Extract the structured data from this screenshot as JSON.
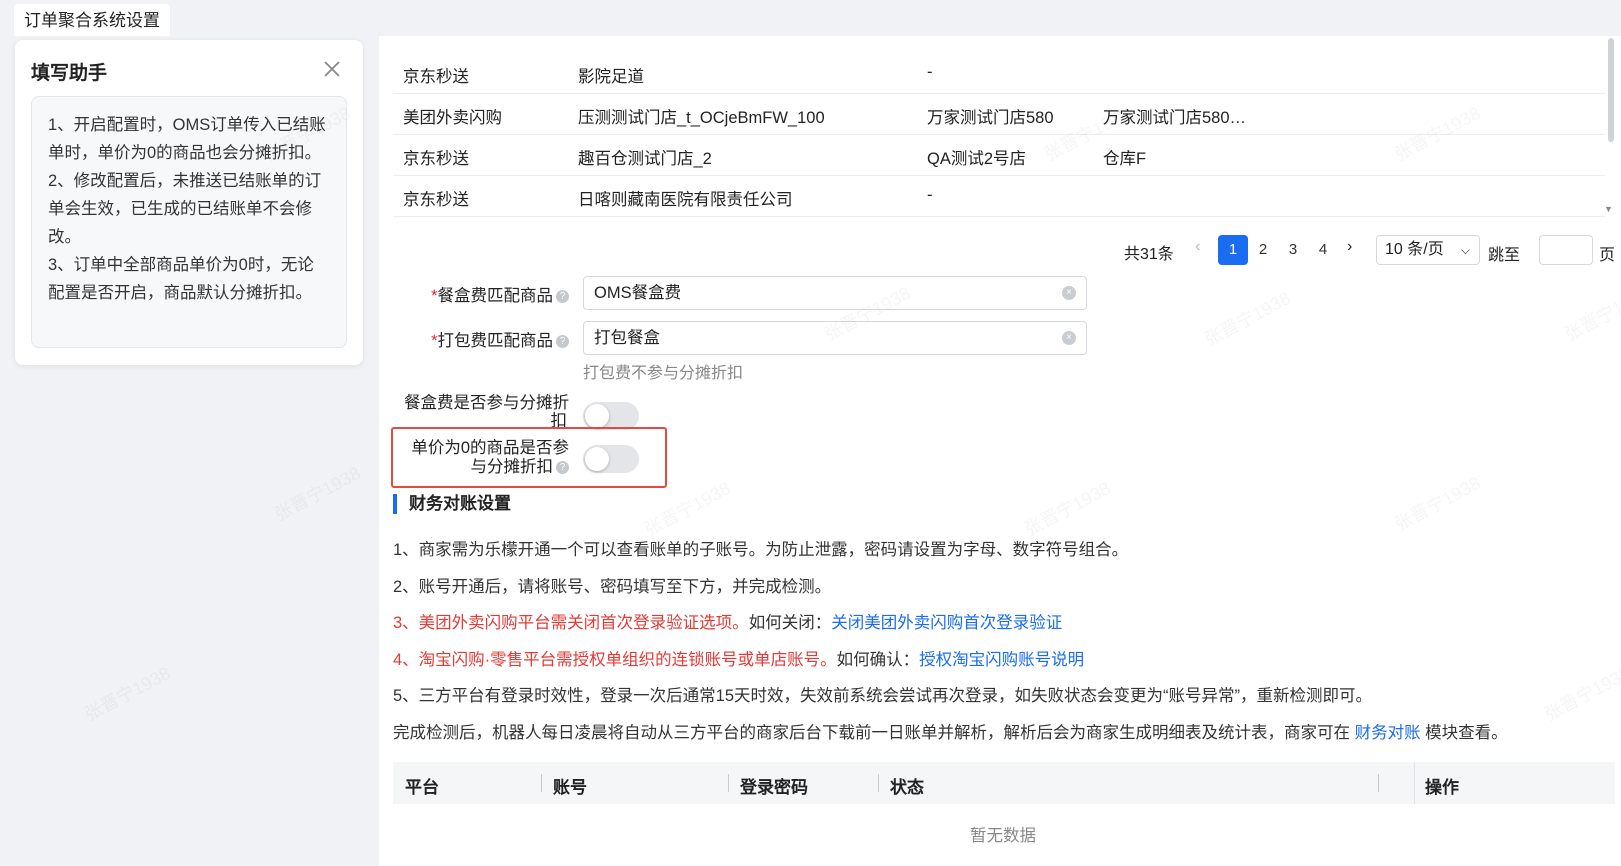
{
  "window_tab": "订单聚合系统设置",
  "helper": {
    "title": "填写助手",
    "notes": [
      "1、开启配置时，OMS订单传入已结账单时，单价为0的商品也会分摊折扣。",
      "2、修改配置后，未推送已结账单的订单会生效，已生成的已结账单不会修改。",
      "3、订单中全部商品单价为0时，无论配置是否开启，商品默认分摊折扣。"
    ]
  },
  "store_table": {
    "rows": [
      [
        "京东秒送",
        "影院足道",
        "-",
        ""
      ],
      [
        "美团外卖闪购",
        "压测测试门店_t_OCjeBmFW_100",
        "万家测试门店580",
        "万家测试门店580…"
      ],
      [
        "京东秒送",
        "趣百仓测试门店_2",
        "QA测试2号店",
        "仓库F"
      ],
      [
        "京东秒送",
        "日喀则藏南医院有限责任公司",
        "-",
        ""
      ]
    ]
  },
  "pagination": {
    "total": "共31条",
    "pages": [
      "1",
      "2",
      "3",
      "4"
    ],
    "current": "1",
    "page_size": "10 条/页",
    "jump_label": "跳至",
    "page_suffix": "页"
  },
  "form": {
    "box_fee_label": "餐盒费匹配商品",
    "box_fee_value": "OMS餐盒费",
    "pack_fee_label": "打包费匹配商品",
    "pack_fee_value": "打包餐盒",
    "pack_fee_hint": "打包费不参与分摊折扣",
    "box_discount_label_1": "餐盒费是否参与分摊折",
    "box_discount_label_2": "扣",
    "zero_price_label_1": "单价为0的商品是否参",
    "zero_price_label_2": "与分摊折扣",
    "box_discount_on": false,
    "zero_price_on": false
  },
  "finance": {
    "title": "财务对账设置",
    "note1": "1、商家需为乐檬开通一个可以查看账单的子账号。为防止泄露，密码请设置为字母、数字符号组合。",
    "note2": "2、账号开通后，请将账号、密码填写至下方，并完成检测。",
    "note3_red": "3、美团外卖闪购平台需关闭首次登录验证选项。",
    "note3_plain": "如何关闭：",
    "note3_link": "关闭美团外卖闪购首次登录验证",
    "note4_red": "4、淘宝闪购·零售平台需授权单组织的连锁账号或单店账号。",
    "note4_plain": "如何确认：",
    "note4_link": "授权淘宝闪购账号说明",
    "note5": "5、三方平台有登录时效性，登录一次后通常15天时效，失效前系统会尝试再次登录，如失败状态会变更为“账号异常”，重新检测即可。",
    "note6_pre": "完成检测后，机器人每日凌晨将自动从三方平台的商家后台下载前一日账单并解析，解析后会为商家生成明细表及统计表，商家可在 ",
    "note6_link": "财务对账",
    "note6_post": " 模块查看。"
  },
  "account_table": {
    "headers": [
      "平台",
      "账号",
      "登录密码",
      "状态",
      "操作"
    ],
    "empty_text": "暂无数据"
  },
  "watermark_text": "张晋宁1938",
  "colors": {
    "primary": "#1a6cf0",
    "danger": "#e53935",
    "highlight_border": "#e64a3e"
  }
}
